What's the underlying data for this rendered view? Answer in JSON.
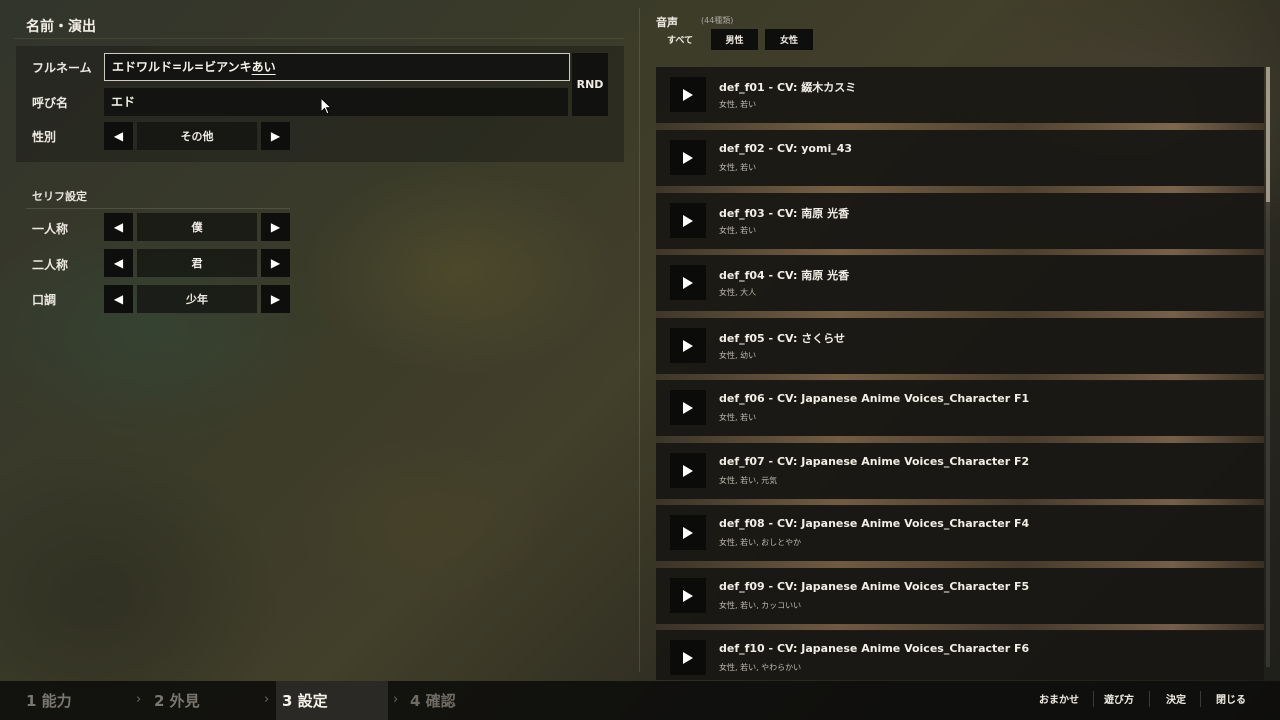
{
  "name_section": {
    "title": "名前・演出",
    "fullname_label": "フルネーム",
    "fullname_value_committed": "エドワルド=ル=ビアンキ",
    "fullname_value_ime": "あい",
    "nickname_label": "呼び名",
    "nickname_value": "エド",
    "rnd_label": "RND",
    "gender_label": "性別",
    "gender_value": "その他"
  },
  "speech_section": {
    "title": "セリフ設定",
    "first_person_label": "一人称",
    "first_person_value": "僕",
    "second_person_label": "二人称",
    "second_person_value": "君",
    "tone_label": "口調",
    "tone_value": "少年"
  },
  "voice_section": {
    "title": "音声",
    "count": "(44種類)",
    "filters": [
      "すべて",
      "男性",
      "女性"
    ],
    "items": [
      {
        "name": "def_f01 - CV: 綴木カスミ",
        "tags": "女性, 若い"
      },
      {
        "name": "def_f02 - CV: yomi_43",
        "tags": "女性, 若い"
      },
      {
        "name": "def_f03 - CV: 南原 光香",
        "tags": "女性, 若い"
      },
      {
        "name": "def_f04 - CV: 南原 光香",
        "tags": "女性, 大人"
      },
      {
        "name": "def_f05 - CV: さくらせ",
        "tags": "女性, 幼い"
      },
      {
        "name": "def_f06 - CV: Japanese Anime Voices_Character F1",
        "tags": "女性, 若い"
      },
      {
        "name": "def_f07 - CV: Japanese Anime Voices_Character F2",
        "tags": "女性, 若い, 元気"
      },
      {
        "name": "def_f08 - CV: Japanese Anime Voices_Character F4",
        "tags": "女性, 若い, おしとやか"
      },
      {
        "name": "def_f09 - CV: Japanese Anime Voices_Character F5",
        "tags": "女性, 若い, カッコいい"
      },
      {
        "name": "def_f10 - CV: Japanese Anime Voices_Character F6",
        "tags": "女性, 若い, やわらかい"
      }
    ]
  },
  "steps": {
    "step1": "1 能力",
    "step2": "2 外見",
    "step3": "3 設定",
    "step4": "4 確認",
    "chevron": "›"
  },
  "actions": {
    "random": "おまかせ",
    "howto": "遊び方",
    "confirm": "決定",
    "close": "閉じる"
  },
  "icons": {
    "prev": "left-triangle-icon",
    "next": "right-triangle-icon",
    "play": "play-icon",
    "cursor": "mouse-cursor-icon"
  },
  "colors": {
    "panel": "#181714",
    "button": "#0e0e0d",
    "text": "#f2eee6",
    "current_step": "#2a2926"
  }
}
